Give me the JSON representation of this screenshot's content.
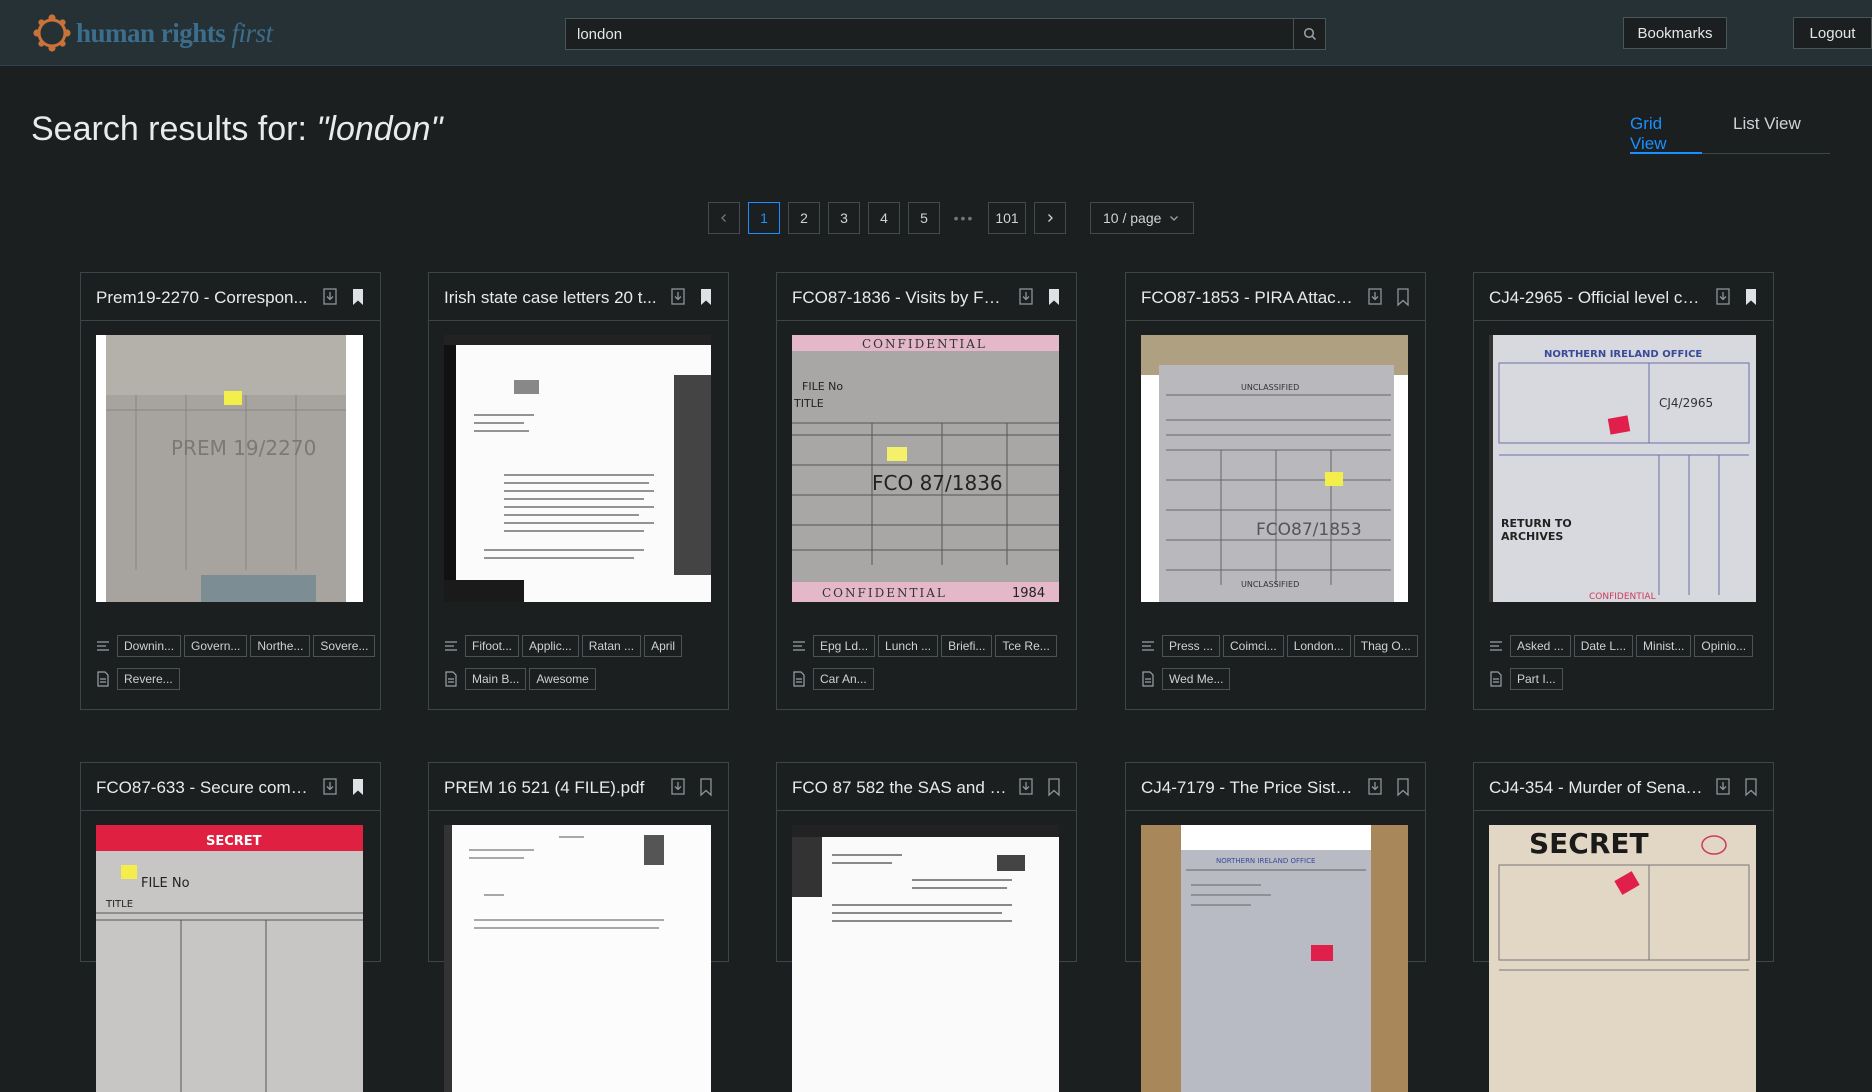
{
  "header": {
    "logo_main": "human rights ",
    "logo_accent": "first",
    "search_value": "london",
    "bookmarks_label": "Bookmarks",
    "logout_label": "Logout"
  },
  "results": {
    "title_prefix": "Search results for: ",
    "query_display": "\"london\""
  },
  "view_tabs": {
    "grid": "Grid View",
    "list": "List View",
    "active": "grid"
  },
  "pagination": {
    "prev": "<",
    "next": ">",
    "pages": [
      "1",
      "2",
      "3",
      "4",
      "5"
    ],
    "ellipsis": "•••",
    "last": "101",
    "current": "1",
    "page_size": "10 / page"
  },
  "cards": [
    {
      "title": "Prem19-2270 - Correspon...",
      "bookmarked": true,
      "keywords": [
        "Downin...",
        "Govern...",
        "Northe...",
        "Sovere..."
      ],
      "docs": [
        "Revere..."
      ]
    },
    {
      "title": "Irish state case letters 20 t...",
      "bookmarked": true,
      "keywords": [
        "Fifoot...",
        "Applic...",
        "Ratan ...",
        "April"
      ],
      "docs": [
        "Main B...",
        "Awesome"
      ]
    },
    {
      "title": "FCO87-1836 - Visits by FCO...",
      "bookmarked": true,
      "keywords": [
        "Epg Ld...",
        "Lunch ...",
        "Briefi...",
        "Tce Re..."
      ],
      "docs": [
        "Car An..."
      ]
    },
    {
      "title": "FCO87-1853 - PIRA Attacks...",
      "bookmarked": false,
      "keywords": [
        "Press ...",
        "Coimci...",
        "London...",
        "Thag O..."
      ],
      "docs": [
        "Wed Me..."
      ]
    },
    {
      "title": "CJ4-2965 - Official level co...",
      "bookmarked": true,
      "keywords": [
        "Asked ...",
        "Date L...",
        "Minist...",
        "Opinio..."
      ],
      "docs": [
        "Part I..."
      ]
    },
    {
      "title": "FCO87-633 - Secure comm...",
      "bookmarked": true,
      "keywords": [],
      "docs": []
    },
    {
      "title": "PREM 16 521 (4 FILE).pdf",
      "bookmarked": false,
      "keywords": [],
      "docs": []
    },
    {
      "title": "FCO 87 582 the SAS and S...",
      "bookmarked": false,
      "keywords": [],
      "docs": []
    },
    {
      "title": "CJ4-7179 - The Price Sister...",
      "bookmarked": false,
      "keywords": [],
      "docs": []
    },
    {
      "title": "CJ4-354 - Murder of Senat...",
      "bookmarked": false,
      "keywords": [],
      "docs": []
    }
  ],
  "thumbnails": {
    "card0": {
      "handwriting": "PREM 19/2270"
    },
    "card2": {
      "header": "CONFIDENTIAL",
      "footer": "CONFIDENTIAL",
      "file_label": "FILE No",
      "title_label": "TITLE",
      "handwriting": "FCO 87/1836",
      "year": "1984"
    },
    "card3": {
      "header": "UNCLASSIFIED",
      "footer": "UNCLASSIFIED",
      "handwriting": "FCO87/1853"
    },
    "card4": {
      "header": "NORTHERN IRELAND OFFICE",
      "handwriting": "CJ4/2965",
      "return_line1": "RETURN TO",
      "return_line2": "ARCHIVES",
      "footer": "CONFIDENTIAL"
    },
    "card5": {
      "header": "SECRET",
      "file_label": "FILE No",
      "title_label": "TITLE"
    },
    "card8": {
      "header": "NORTHERN IRELAND OFFICE"
    },
    "card9": {
      "header": "SECRET"
    }
  },
  "colors": {
    "accent": "#1890ff",
    "background": "#1b1f20",
    "topbar": "#253135",
    "logo": "#3d6d8c",
    "logo_ring": "#c9733a"
  }
}
